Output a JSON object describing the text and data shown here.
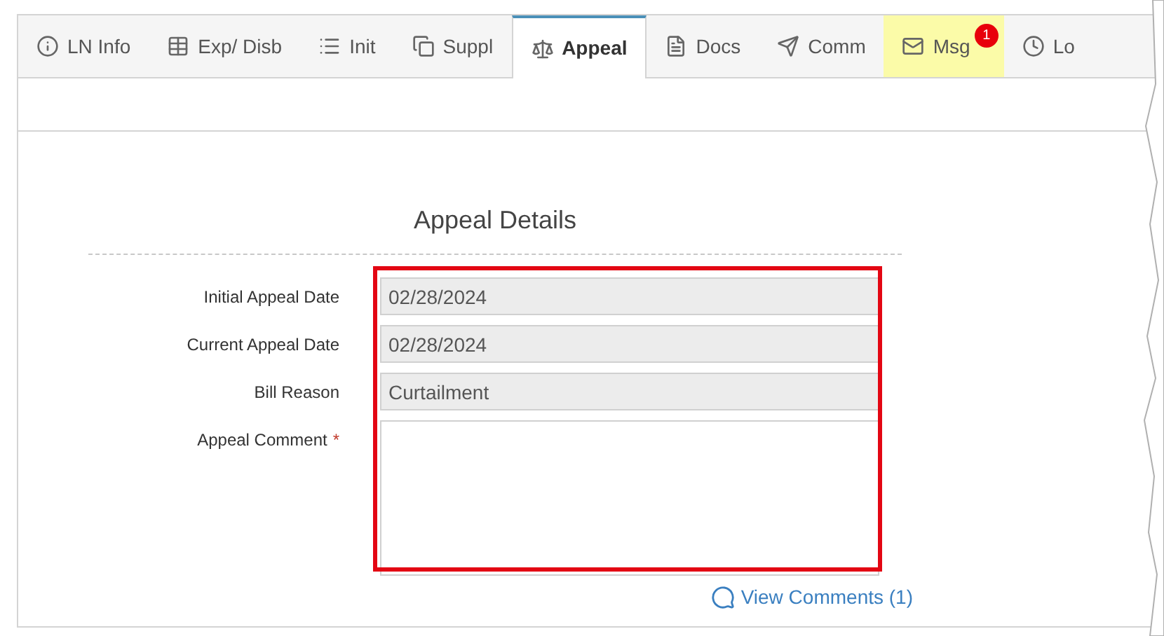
{
  "tabs": [
    {
      "label": "LN Info",
      "kind": "info",
      "selected": false,
      "highlighted": false
    },
    {
      "label": "Exp/ Disb",
      "kind": "table",
      "selected": false,
      "highlighted": false
    },
    {
      "label": "Init",
      "kind": "list",
      "selected": false,
      "highlighted": false
    },
    {
      "label": "Suppl",
      "kind": "copy",
      "selected": false,
      "highlighted": false
    },
    {
      "label": "Appeal",
      "kind": "scale",
      "selected": true,
      "highlighted": false
    },
    {
      "label": "Docs",
      "kind": "file",
      "selected": false,
      "highlighted": false
    },
    {
      "label": "Comm",
      "kind": "send",
      "selected": false,
      "highlighted": false
    },
    {
      "label": "Msg",
      "kind": "mail",
      "selected": false,
      "highlighted": true,
      "badge": "1"
    },
    {
      "label": "Lo",
      "kind": "clock",
      "selected": false,
      "highlighted": false
    }
  ],
  "section_title": "Appeal Details",
  "fields": [
    {
      "label": "Initial Appeal Date",
      "kind": "input",
      "value": "02/28/2024",
      "disabled": true
    },
    {
      "label": "Current Appeal Date",
      "kind": "input",
      "value": "02/28/2024",
      "disabled": true
    },
    {
      "label": "Bill Reason",
      "kind": "input",
      "value": "Curtailment",
      "disabled": true
    },
    {
      "label": "Appeal Comment",
      "kind": "textarea",
      "required_mark": "*",
      "disabled": false
    }
  ],
  "view_comments_link": "View Comments (1)"
}
